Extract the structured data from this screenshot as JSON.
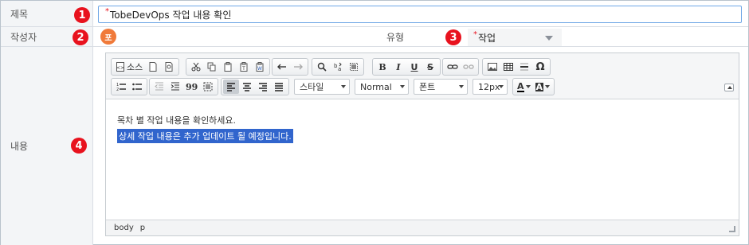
{
  "form": {
    "title_label": "제목",
    "title_value": "TobeDevOps 작업 내용 확인",
    "author_label": "작성자",
    "author_avatar": "포",
    "type_label": "유형",
    "type_value": "작업",
    "content_label": "내용",
    "required_mark": "*"
  },
  "badges": [
    "1",
    "2",
    "3",
    "4"
  ],
  "toolbar": {
    "source_label": "소스",
    "style_combo": "스타일",
    "format_combo": "Normal",
    "font_combo": "폰트",
    "size_combo": "12px",
    "bold": "B",
    "italic": "I",
    "underline": "U",
    "strike": "S",
    "omega": "Ω",
    "quote": "99",
    "text_color_btn": "A",
    "bg_color_btn": "A"
  },
  "editor": {
    "line1": "목차 별 작업 내용을 확인하세요.",
    "line2": "상세 작업 내용은 추가 업데이트 될 예정입니다."
  },
  "statusbar": [
    "body",
    "p"
  ],
  "colors": {
    "badge": "#e8121e",
    "avatar": "#f07a3a",
    "selection": "#3165cd",
    "title_border": "#6fa7e6"
  }
}
